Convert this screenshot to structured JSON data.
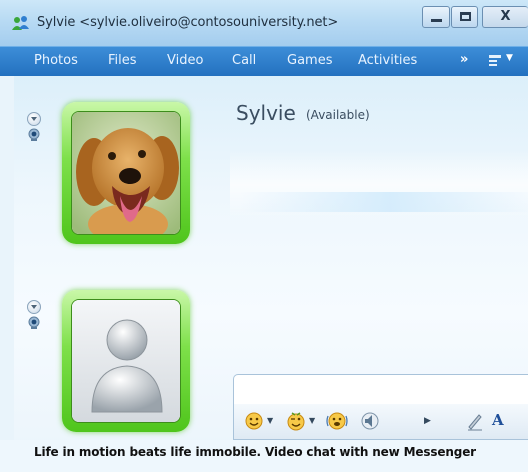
{
  "window": {
    "title": "Sylvie <sylvie.oliveiro@contosouniversity.net>",
    "controls": {
      "minimize": "minimize",
      "maximize": "maximize",
      "close": "X"
    }
  },
  "menu": {
    "items": [
      "Photos",
      "Files",
      "Video",
      "Call",
      "Games",
      "Activities"
    ],
    "overflow": "»"
  },
  "contact": {
    "name": "Sylvie",
    "status": "(Available)"
  },
  "composer": {
    "value": "",
    "placeholder": ""
  },
  "toolbar": {
    "font_button": "A"
  },
  "status_bar": {
    "text": "Life in motion beats life immobile. Video chat with new Messenger"
  },
  "colors": {
    "menubar": "#2370bf",
    "avatar_frame": "#5fd12a",
    "title_bar": "#b6d9f3"
  },
  "icons": {
    "app": "messenger-people-icon",
    "contact_avatar": "golden-retriever-photo",
    "self_avatar": "default-person-silhouette"
  }
}
